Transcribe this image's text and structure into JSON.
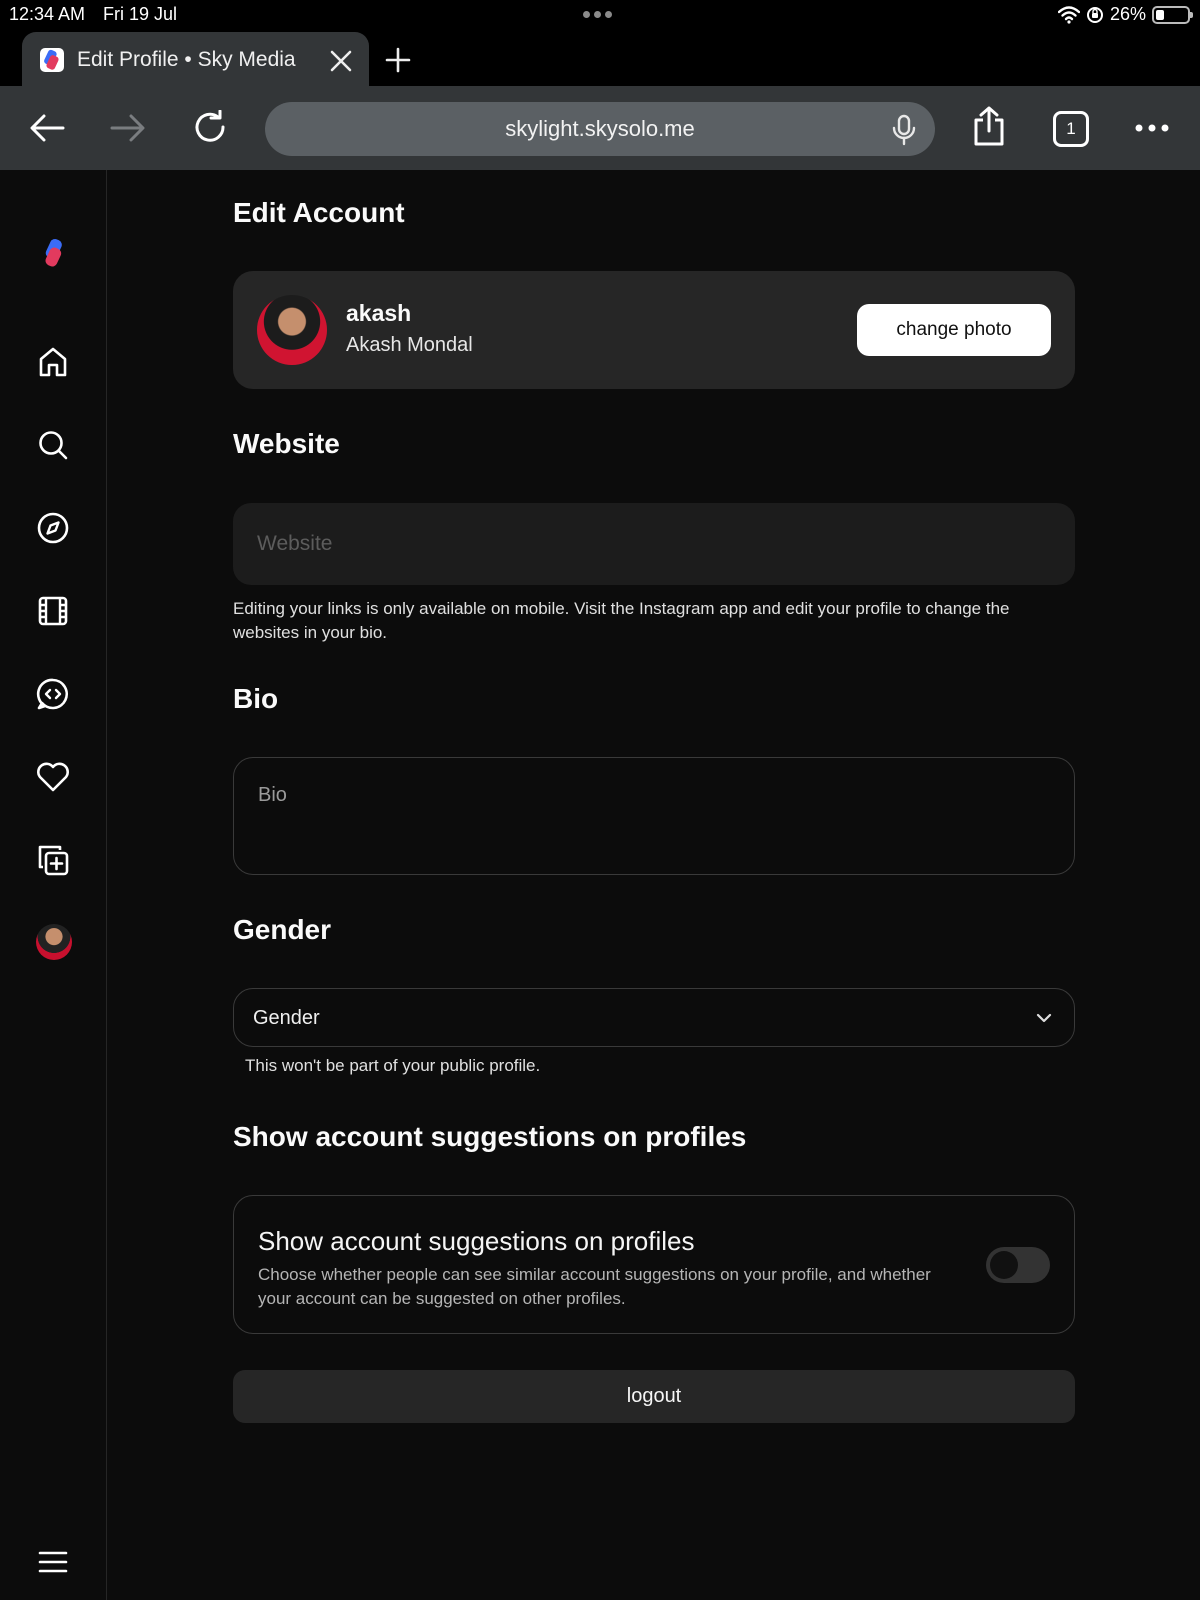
{
  "status_bar": {
    "time": "12:34 AM",
    "date": "Fri 19 Jul",
    "battery_percent_label": "26%",
    "battery_level": 0.26
  },
  "browser": {
    "tab_title": "Edit Profile • Sky Media",
    "url": "skylight.skysolo.me",
    "tab_count": "1",
    "colors": {
      "chrome": "#333638",
      "url_bar": "#5b6064"
    }
  },
  "sidebar": {
    "items": [
      {
        "icon": "app-logo-icon"
      },
      {
        "icon": "home-icon"
      },
      {
        "icon": "search-icon"
      },
      {
        "icon": "explore-compass-icon"
      },
      {
        "icon": "reels-film-icon"
      },
      {
        "icon": "messages-icon"
      },
      {
        "icon": "heart-icon"
      },
      {
        "icon": "create-plus-icon"
      },
      {
        "icon": "profile-avatar"
      },
      {
        "icon": "menu-hamburger-icon"
      }
    ]
  },
  "main": {
    "page_title": "Edit Account",
    "profile": {
      "username": "akash",
      "full_name": "Akash Mondal",
      "change_photo_label": "change photo"
    },
    "website": {
      "heading": "Website",
      "placeholder": "Website",
      "value": "",
      "note": "Editing your links is only available on mobile. Visit the Instagram app and edit your profile to change the websites in your bio."
    },
    "bio": {
      "heading": "Bio",
      "placeholder": "Bio",
      "value": ""
    },
    "gender": {
      "heading": "Gender",
      "selected": "Gender",
      "note": "This won't be part of your public profile."
    },
    "suggestions": {
      "heading": "Show account suggestions on profiles",
      "card_title": "Show account suggestions on profiles",
      "card_desc": "Choose whether people can see similar account suggestions on your profile, and whether your account can be suggested on other profiles.",
      "enabled": false
    },
    "logout_label": "logout"
  }
}
